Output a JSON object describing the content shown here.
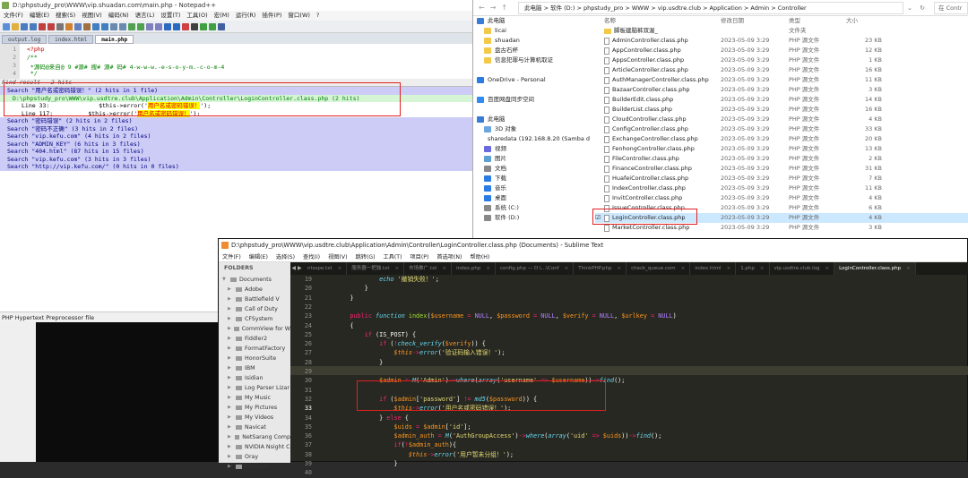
{
  "npp": {
    "title": "D:\\phpstudy_pro\\WWW\\vip.shuadan.com\\main.php - Notepad++",
    "menu": [
      "文件(F)",
      "编辑(E)",
      "搜索(S)",
      "视图(V)",
      "编码(N)",
      "语言(L)",
      "设置(T)",
      "工具(O)",
      "宏(M)",
      "运行(R)",
      "插件(P)",
      "窗口(W)",
      "?"
    ],
    "tabs": [
      "output.log",
      "index.html",
      "main.php"
    ],
    "code_lines": [
      {
        "n": "1",
        "text": "<?php"
      },
      {
        "n": "2",
        "text": "/**"
      },
      {
        "n": "3",
        "text": " *源码@来自@ 9 #源# 搜# 源# 码# 4-w-w-w.-e-s-o-y-m.-c-o-m-4"
      },
      {
        "n": "4",
        "text": " */"
      }
    ],
    "find_title": "Find result - 2 hits",
    "find_rows": [
      {
        "type": "search",
        "text": "Search \"用户名或密码错误！\" (2 hits in 1 file)"
      },
      {
        "type": "file",
        "text": "D:\\phpstudy_pro\\WWW\\vip.usdtre.club\\Application\\Admin\\Controller\\LoginController.class.php (2 hits)"
      },
      {
        "type": "line",
        "text": "Line 33:              $this->error('用户名或密码错误！');"
      },
      {
        "type": "line",
        "text": "Line 117:          $this->error('用户名或密码错误！');"
      },
      {
        "type": "search",
        "text": "Search \"密码错误\" (2 hits in 2 files)"
      },
      {
        "type": "search",
        "text": "Search \"密码不正确\" (3 hits in 2 files)"
      },
      {
        "type": "search",
        "text": "Search \"vip.kefu.com\" (4 hits in 2 files)"
      },
      {
        "type": "search",
        "text": "Search \"ADMIN_KEY\" (6 hits in 3 files)"
      },
      {
        "type": "search",
        "text": "Search \"404.html\" (87 hits in 15 files)"
      },
      {
        "type": "search",
        "text": "Search \"vip.kefu.com\" (3 hits in 3 files)"
      },
      {
        "type": "search",
        "text": "Search \"http://vip.kefu.com/\" (0 hits in 0 files)"
      }
    ],
    "status": "PHP Hypertext Preprocessor file"
  },
  "explorer": {
    "breadcrumb": "此电脑  >  软件 (D:)  >  phpstudy_pro  >  WWW  >  vip.usdtre.club  >  Application  >  Admin  >  Controller",
    "search_placeholder": "在 Contr",
    "nav_items": [
      {
        "label": "此电脑",
        "color": "#3a7bd5"
      },
      {
        "label": "licai",
        "color": "#f3c94a"
      },
      {
        "label": "shuadan",
        "color": "#f3c94a"
      },
      {
        "label": "盘古石杯",
        "color": "#f3c94a"
      },
      {
        "label": "信息犯罪与计算机取证",
        "color": "#f3c94a"
      },
      {
        "label": "",
        "color": "transparent"
      },
      {
        "label": "OneDrive - Personal",
        "color": "#2a7be4"
      },
      {
        "label": "",
        "color": "transparent"
      },
      {
        "label": "百度网盘同步空间",
        "color": "#2f8cf0"
      },
      {
        "label": "",
        "color": "transparent"
      },
      {
        "label": "此电脑",
        "color": "#3a7bd5"
      },
      {
        "label": "3D 对象",
        "color": "#6aa6e0"
      },
      {
        "label": "sharedata (192.168.8.20 (Samba d",
        "color": "#888888"
      },
      {
        "label": "视频",
        "color": "#6a6ae0"
      },
      {
        "label": "图片",
        "color": "#5aa0d0"
      },
      {
        "label": "文档",
        "color": "#888888"
      },
      {
        "label": "下载",
        "color": "#2a7be4"
      },
      {
        "label": "音乐",
        "color": "#2a7be4"
      },
      {
        "label": "桌面",
        "color": "#2a7be4"
      },
      {
        "label": "系统 (C:)",
        "color": "#888888"
      },
      {
        "label": "软件 (D:)",
        "color": "#888888"
      }
    ],
    "headers": [
      "名称",
      "修改日期",
      "类型",
      "大小"
    ],
    "files": [
      {
        "name": "脚板建脑裤双渥_",
        "date": "",
        "type": "文件夹",
        "size": "",
        "folder": true
      },
      {
        "name": "AdminController.class.php",
        "date": "2023-05-09 3:29",
        "type": "PHP 源文件",
        "size": "23 KB"
      },
      {
        "name": "AppController.class.php",
        "date": "2023-05-09 3:29",
        "type": "PHP 源文件",
        "size": "12 KB"
      },
      {
        "name": "AppsController.class.php",
        "date": "2023-05-09 3:29",
        "type": "PHP 源文件",
        "size": "1 KB"
      },
      {
        "name": "ArticleController.class.php",
        "date": "2023-05-09 3:29",
        "type": "PHP 源文件",
        "size": "16 KB"
      },
      {
        "name": "AuthManagerController.class.php",
        "date": "2023-05-09 3:29",
        "type": "PHP 源文件",
        "size": "11 KB"
      },
      {
        "name": "BazaarController.class.php",
        "date": "2023-05-09 3:29",
        "type": "PHP 源文件",
        "size": "3 KB"
      },
      {
        "name": "BuilderEdit.class.php",
        "date": "2023-05-09 3:29",
        "type": "PHP 源文件",
        "size": "14 KB"
      },
      {
        "name": "BuilderList.class.php",
        "date": "2023-05-09 3:29",
        "type": "PHP 源文件",
        "size": "16 KB"
      },
      {
        "name": "CloudController.class.php",
        "date": "2023-05-09 3:29",
        "type": "PHP 源文件",
        "size": "4 KB"
      },
      {
        "name": "ConfigController.class.php",
        "date": "2023-05-09 3:29",
        "type": "PHP 源文件",
        "size": "33 KB"
      },
      {
        "name": "ExchangeController.class.php",
        "date": "2023-05-09 3:29",
        "type": "PHP 源文件",
        "size": "20 KB"
      },
      {
        "name": "FenhongController.class.php",
        "date": "2023-05-09 3:29",
        "type": "PHP 源文件",
        "size": "13 KB"
      },
      {
        "name": "FileController.class.php",
        "date": "2023-05-09 3:29",
        "type": "PHP 源文件",
        "size": "2 KB"
      },
      {
        "name": "FinanceController.class.php",
        "date": "2023-05-09 3:29",
        "type": "PHP 源文件",
        "size": "31 KB"
      },
      {
        "name": "HuafeiController.class.php",
        "date": "2023-05-09 3:29",
        "type": "PHP 源文件",
        "size": "7 KB"
      },
      {
        "name": "IndexController.class.php",
        "date": "2023-05-09 3:29",
        "type": "PHP 源文件",
        "size": "11 KB"
      },
      {
        "name": "InvitController.class.php",
        "date": "2023-05-09 3:29",
        "type": "PHP 源文件",
        "size": "4 KB"
      },
      {
        "name": "IssueController.class.php",
        "date": "2023-05-09 3:29",
        "type": "PHP 源文件",
        "size": "6 KB"
      },
      {
        "name": "LoginController.class.php",
        "date": "2023-05-09 3:29",
        "type": "PHP 源文件",
        "size": "4 KB",
        "selected": true
      },
      {
        "name": "MarketController.class.php",
        "date": "2023-05-09 3:29",
        "type": "PHP 源文件",
        "size": "3 KB"
      }
    ]
  },
  "sublime": {
    "title": "D:\\phpstudy_pro\\WWW\\vip.usdtre.club\\Application\\Admin\\Controller\\LoginController.class.php (Documents) - Sublime Text",
    "menu": [
      "文件(F)",
      "编辑(E)",
      "选择(S)",
      "查找(I)",
      "视图(V)",
      "跳转(G)",
      "工具(T)",
      "项目(P)",
      "首选项(N)",
      "帮助(H)"
    ],
    "folders_label": "FOLDERS",
    "folders": [
      "Documents",
      "Adobe",
      "Battlefield V",
      "Call of Duty",
      "CFSystem",
      "CommView for W",
      "Fiddler2",
      "FormatFactory",
      "HonorSuite",
      "IBM",
      "Isidian",
      "Log Parser Lizar",
      "My Music",
      "My Pictures",
      "My Videos",
      "Navicat",
      "NetSarang Comp",
      "NVIDIA Nsight C",
      "Oray",
      "Panqute"
    ],
    "tabs": [
      "ntsspe.txt",
      "服务器一把独.txt",
      "市场推广.txt",
      "index.php",
      "config.php — D:\\...\\Conf",
      "ThinkPHP.php",
      "check_queue.com",
      "index.html",
      "1.php",
      "vip.usdtre.club.log",
      "LoginController.class.php"
    ],
    "line_numbers": [
      "19",
      "20",
      "21",
      "22",
      "23",
      "24",
      "25",
      "26",
      "27",
      "28",
      "29",
      "30",
      "31",
      "32",
      "33",
      "34",
      "35",
      "36",
      "37",
      "38",
      "39",
      "40"
    ],
    "cur_line": "33"
  }
}
